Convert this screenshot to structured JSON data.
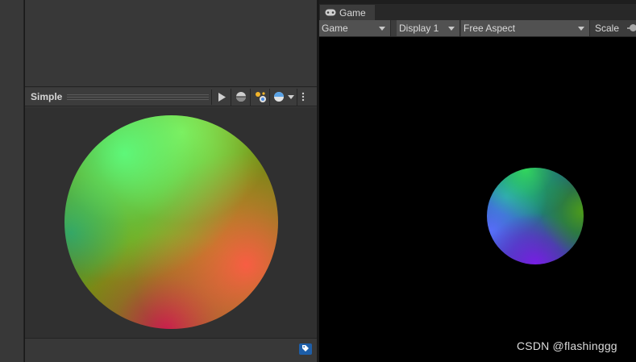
{
  "preview": {
    "title": "Simple"
  },
  "game": {
    "tab_label": "Game",
    "toolbar": {
      "view_select": "Game",
      "display_select": "Display 1",
      "aspect_select": "Free Aspect",
      "scale_label": "Scale"
    }
  },
  "watermark": "CSDN @flashinggg",
  "colors": {
    "panel_bg": "#383838",
    "preview_bg": "#303030",
    "game_bg": "#000000",
    "tag_accent": "#1d5ea8"
  },
  "icons": [
    "play-icon",
    "sphere-mesh-icon",
    "lighting-icon",
    "material-ball-icon",
    "chevron-down-icon",
    "kebab-menu-icon",
    "gamepad-icon",
    "tag-icon"
  ]
}
